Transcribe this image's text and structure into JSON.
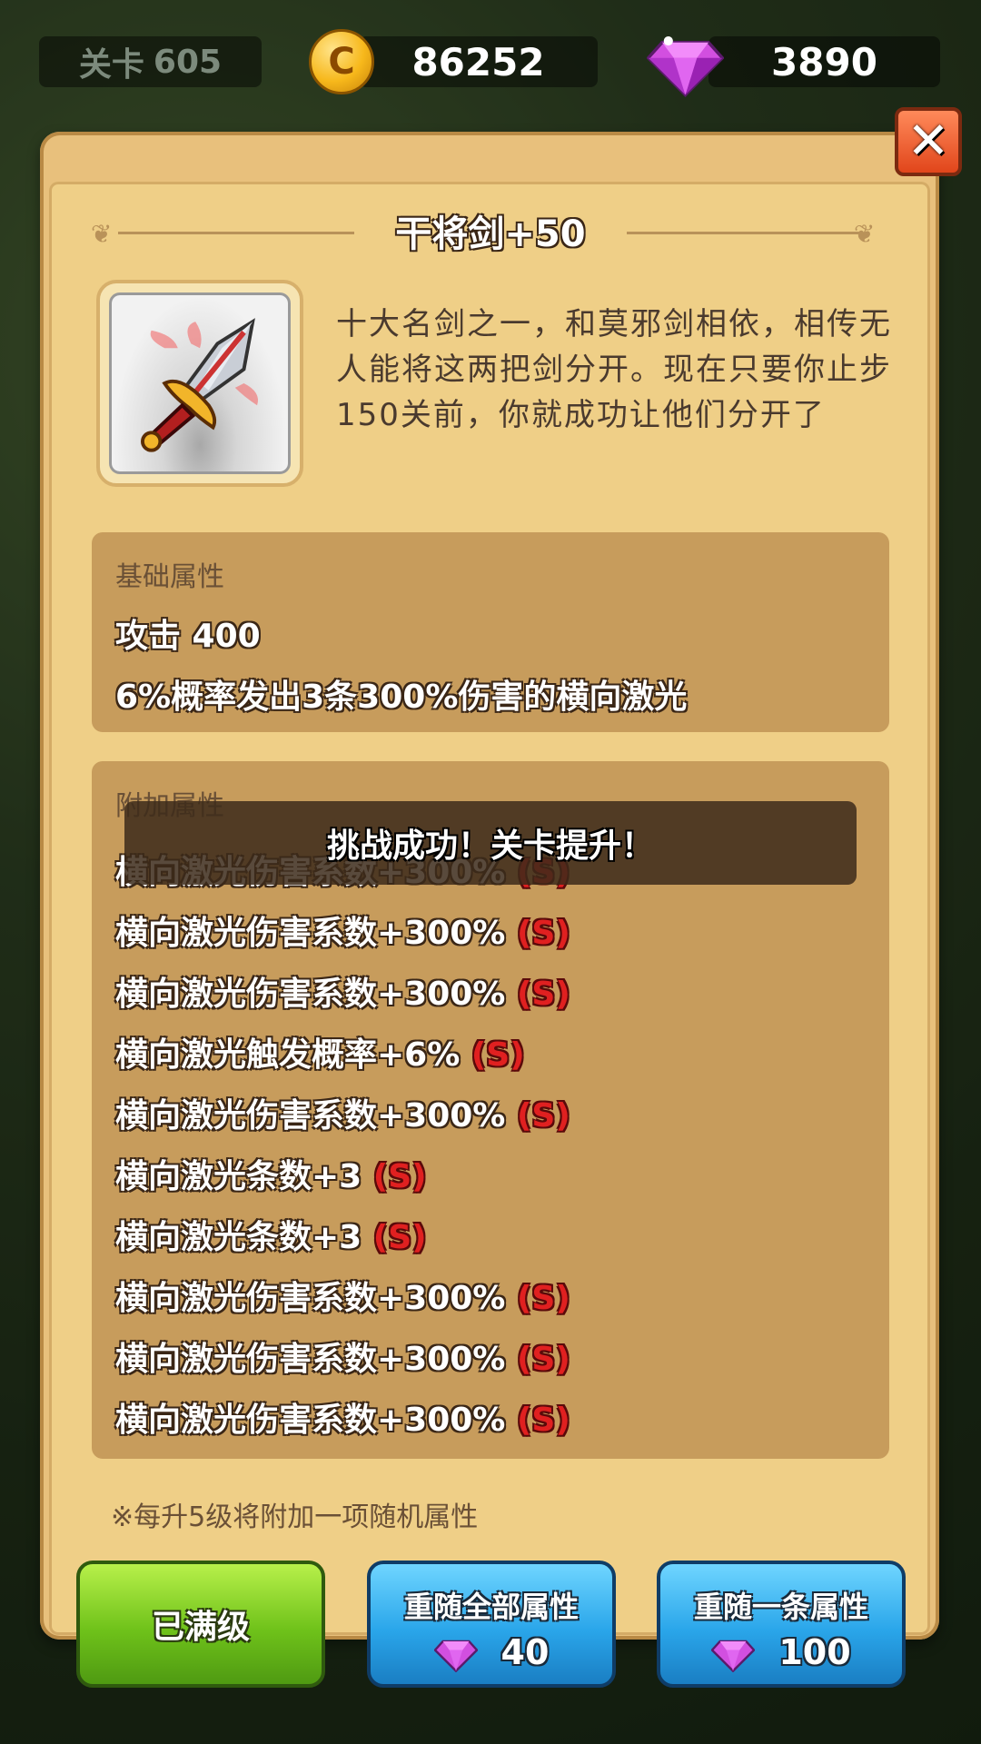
{
  "topbar": {
    "level_label": "关卡",
    "level_value": "605",
    "coins": "86252",
    "coin_icon_glyph": "C",
    "gems": "3890"
  },
  "close_button": {
    "glyph": "✕"
  },
  "item": {
    "title": "干将剑+50",
    "description": "十大名剑之一，和莫邪剑相依，相传无人能将这两把剑分开。现在只要你止步150关前，你就成功让他们分开了"
  },
  "base_section": {
    "title": "基础属性",
    "stats": [
      "攻击 400",
      "6%概率发出3条300%伤害的横向激光"
    ]
  },
  "extra_section": {
    "title": "附加属性",
    "stats": [
      {
        "text": "横向激光伤害系数+300%",
        "grade": "(S)"
      },
      {
        "text": "横向激光伤害系数+300%",
        "grade": "(S)"
      },
      {
        "text": "横向激光伤害系数+300%",
        "grade": "(S)"
      },
      {
        "text": "横向激光触发概率+6%",
        "grade": "(S)"
      },
      {
        "text": "横向激光伤害系数+300%",
        "grade": "(S)"
      },
      {
        "text": "横向激光条数+3",
        "grade": "(S)"
      },
      {
        "text": "横向激光条数+3",
        "grade": "(S)"
      },
      {
        "text": "横向激光伤害系数+300%",
        "grade": "(S)"
      },
      {
        "text": "横向激光伤害系数+300%",
        "grade": "(S)"
      },
      {
        "text": "横向激光伤害系数+300%",
        "grade": "(S)"
      }
    ]
  },
  "toast": "挑战成功！关卡提升！",
  "note": "※每升5级将附加一项随机属性",
  "buttons": {
    "max_level": "已满级",
    "reroll_all": {
      "label": "重随全部属性",
      "cost": "40"
    },
    "reroll_one": {
      "label": "重随一条属性",
      "cost": "100"
    }
  },
  "colors": {
    "panel": "#e8c07c",
    "section": "#c79c5c",
    "grade_red": "#e02020",
    "button_green": "#6fc21a",
    "button_blue": "#2aa6ea",
    "gem": "#d24fe0",
    "coin": "#f7b81b"
  }
}
